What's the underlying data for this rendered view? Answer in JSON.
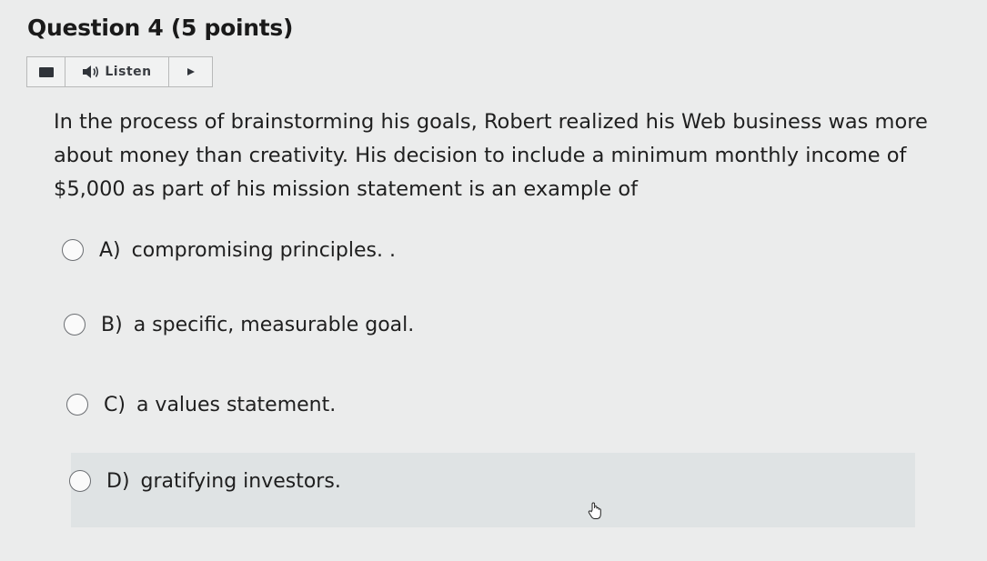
{
  "question": {
    "title": "Question 4 (5 points)",
    "text": "In the process of brainstorming his goals, Robert realized his Web business was more about money than creativity. His decision to include a minimum monthly income of $5,000 as part of his mission statement is an example of"
  },
  "listen_bar": {
    "menu_icon": "hamburger-icon",
    "speaker_icon": "speaker-icon",
    "listen_label": "Listen",
    "play_icon": "play-icon"
  },
  "options": [
    {
      "letter": "A)",
      "text": "compromising principles. ."
    },
    {
      "letter": "B)",
      "text": "a specific, measurable goal."
    },
    {
      "letter": "C)",
      "text": "a values statement."
    },
    {
      "letter": "D)",
      "text": "gratifying investors."
    }
  ],
  "cursor_icon": "hand-cursor-icon",
  "colors": {
    "background": "#ebecec",
    "hover_row": "#dfe3e4",
    "text": "#1f1f1f"
  }
}
